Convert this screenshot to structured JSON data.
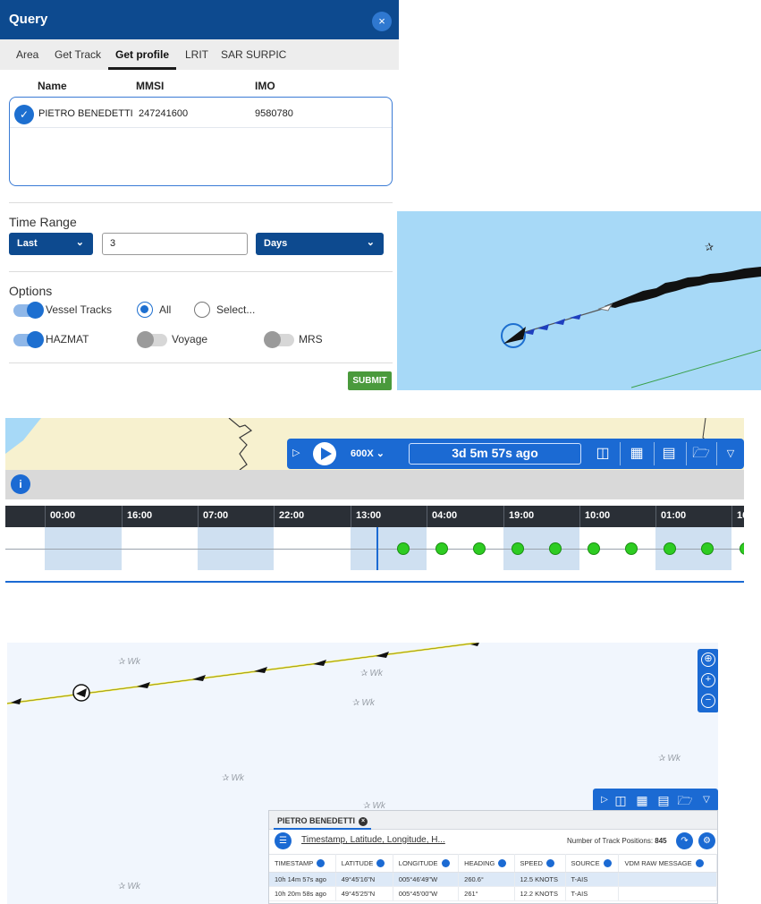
{
  "query": {
    "title": "Query",
    "close_symbol": "×",
    "tabs": [
      "Area",
      "Get Track",
      "Get profile",
      "LRIT",
      "SAR SURPIC"
    ],
    "active_tab": "Get profile",
    "columns": [
      "Name",
      "MMSI",
      "IMO"
    ],
    "vessel": {
      "name": "PIETRO BENEDETTI",
      "mmsi": "247241600",
      "imo": "9580780"
    },
    "time_range": {
      "label": "Time Range",
      "mode": "Last",
      "amount": "3",
      "unit": "Days"
    },
    "options": {
      "label": "Options",
      "vessel_tracks": {
        "label": "Vessel Tracks",
        "on": true
      },
      "radio_all": {
        "label": "All",
        "selected": true
      },
      "radio_select": {
        "label": "Select...",
        "selected": false
      },
      "hazmat": {
        "label": "HAZMAT",
        "on": true
      },
      "voyage": {
        "label": "Voyage",
        "on": false
      },
      "mrs": {
        "label": "MRS",
        "on": false
      }
    },
    "submit_label": "SUBMIT"
  },
  "playback": {
    "speed": "600X",
    "elapsed": "3d 5m 57s ago",
    "info_symbol": "i",
    "ticks": [
      "00:00",
      "16:00",
      "07:00",
      "22:00",
      "13:00",
      "04:00",
      "19:00",
      "10:00",
      "01:00",
      "16"
    ],
    "position_count_dots": 11
  },
  "bottom_map": {
    "wreck_label": "Wk"
  },
  "track_table": {
    "tab_label": "PIETRO BENEDETTI",
    "search_placeholder": "Timestamp, Latitude, Longitude, H...",
    "count_label": "Number of Track Positions:",
    "count_value": "845",
    "headers": [
      "TIMESTAMP",
      "LATITUDE",
      "LONGITUDE",
      "HEADING",
      "SPEED",
      "SOURCE",
      "VDM RAW MESSAGE"
    ],
    "rows": [
      [
        "10h 14m 57s ago",
        "49°45'16\"N",
        "005°46'49\"W",
        "260.6°",
        "12.5 KNOTS",
        "T-AIS",
        ""
      ],
      [
        "10h 20m 58s ago",
        "49°45'25\"N",
        "005°45'00\"W",
        "261°",
        "12.2 KNOTS",
        "T-AIS",
        ""
      ]
    ]
  },
  "colors": {
    "header_navy": "#0d4a8f",
    "accent_blue": "#1b6ad3",
    "submit_green": "#4a9a3c",
    "sea_blue": "#a7d9f7",
    "track_yellow": "#f2ea2c",
    "dot_green": "#2ecc22"
  }
}
